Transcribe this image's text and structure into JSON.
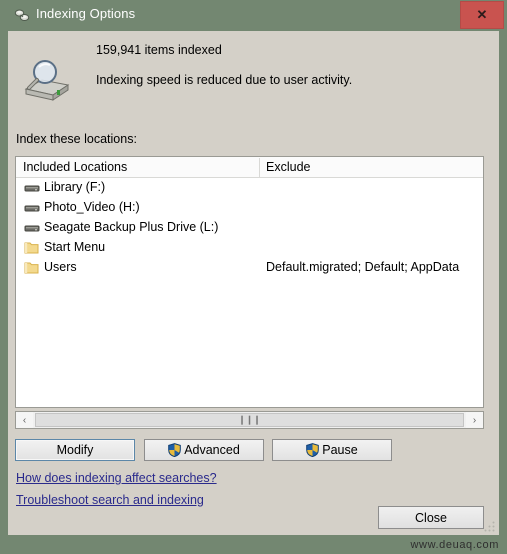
{
  "window": {
    "title": "Indexing Options",
    "title_icon": "indexing-options-icon",
    "close_label": "✕",
    "border_color": "#738771",
    "dialog_bg": "#d4d0c8",
    "close_button_color": "#c9534f"
  },
  "status": {
    "icon": "magnifier-over-drive-icon",
    "items_indexed": "159,941 items indexed",
    "message": "Indexing speed is reduced due to user activity."
  },
  "locations": {
    "label": "Index these locations:",
    "columns": [
      "Included Locations",
      "Exclude"
    ],
    "rows": [
      {
        "icon": "drive-icon",
        "name": "Library (F:)",
        "exclude": ""
      },
      {
        "icon": "drive-icon",
        "name": "Photo_Video (H:)",
        "exclude": ""
      },
      {
        "icon": "drive-icon",
        "name": "Seagate Backup Plus Drive  (L:)",
        "exclude": ""
      },
      {
        "icon": "folder-icon",
        "name": "Start Menu",
        "exclude": ""
      },
      {
        "icon": "folder-icon",
        "name": "Users",
        "exclude": "Default.migrated; Default; AppData"
      }
    ]
  },
  "scrollbar": {
    "left_arrow": "‹",
    "right_arrow": "›",
    "grip": "❙❙❙"
  },
  "buttons": {
    "modify": "Modify",
    "advanced": "Advanced",
    "pause": "Pause",
    "close": "Close"
  },
  "links": {
    "affect_searches": "How does indexing affect searches?",
    "troubleshoot": "Troubleshoot search and indexing",
    "color": "#2a2a8c"
  },
  "watermark": {
    "text": "www.deuaq.com"
  }
}
